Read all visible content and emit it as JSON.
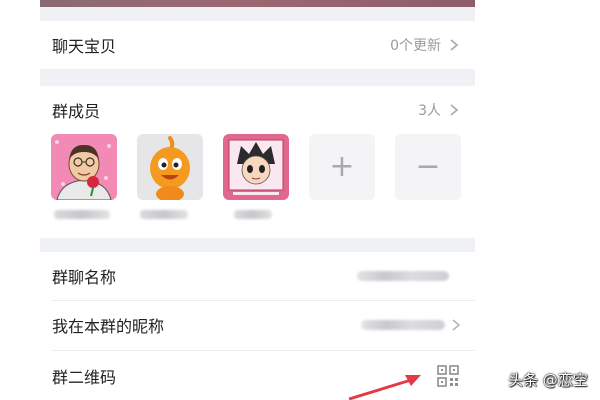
{
  "chat_treasure": {
    "label": "聊天宝贝",
    "value": "0个更新"
  },
  "group_members": {
    "label": "群成员",
    "count": "3人",
    "avatars": [
      {
        "icon": "man-with-rose-avatar"
      },
      {
        "icon": "orange-cartoon-avatar"
      },
      {
        "icon": "anime-character-avatar"
      }
    ],
    "add_symbol": "+",
    "remove_symbol": "−"
  },
  "group_settings": {
    "group_name_label": "群聊名称",
    "my_nickname_label": "我在本群的昵称",
    "qr_code_label": "群二维码"
  },
  "watermark": "头条 @恋空",
  "colors": {
    "background": "#f0f1f4",
    "card": "#ffffff",
    "text_primary": "#222222",
    "text_secondary": "#9a9a9a",
    "arrow": "#e53945"
  }
}
